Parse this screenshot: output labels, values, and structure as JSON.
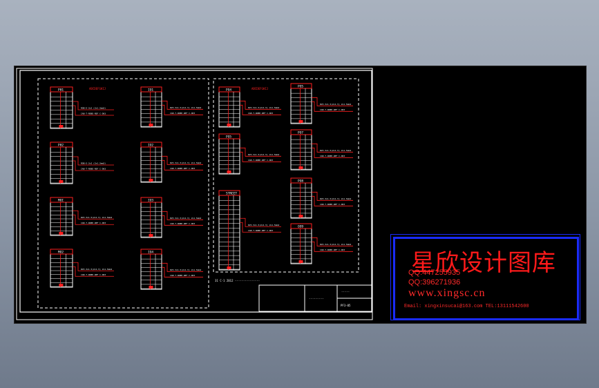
{
  "sheet": {
    "left_panels": [
      {
        "id": "P01",
        "lines": [
          "ROB-E-2x2 (2x1.5mm2)",
          "CAB-T-ROBE-REF  C-D03"
        ]
      },
      {
        "id": "P02",
        "lines": [
          "ROB-E-2x2 (2x1.5mm2)",
          "CAB-T-ROBE-REF  C-D03"
        ]
      },
      {
        "id": "MOI",
        "lines": [
          "RVV-3x1.5(2x1.5) 2x1.5mm2",
          "CAB-T-ROBE-REF  C-D03"
        ]
      },
      {
        "id": "MO2",
        "lines": [
          "RVV-3x1.5(2x1.5) 2x1.5mm2",
          "CAB-T-ROBE-REF  C-D03"
        ]
      }
    ],
    "mid_panels": [
      {
        "id": "IO1",
        "lines": [
          "RVV-3x1.5(2x1.5) 2x1.5mm2",
          "CAB-T-ROBE-REF  C-D03"
        ]
      },
      {
        "id": "IO2",
        "lines": [
          "RVV-3x1.5(2x1.5) 2x1.5mm2",
          "CAB-T-ROBE-REF  C-D03"
        ]
      },
      {
        "id": "IO3",
        "lines": [
          "RVV-3x1.5(2x1.5) 2x1.5mm2",
          "CAB-T-ROBE-REF  C-D03"
        ]
      },
      {
        "id": "IO4",
        "lines": [
          "RVV-3x1.5(2x1.5) 2x1.5mm2",
          "CAB-T-ROBE-REF  C-D03"
        ]
      }
    ],
    "right_panels": [
      {
        "id": "PO4",
        "lines": [
          "RVV-3x1.5(2x1.5) 2x1.5mm2",
          "CAB-T-ROBE-REF  C-D03"
        ]
      },
      {
        "id": "PO5",
        "lines": [
          "RVV-3x1.5(2x1.5) 2x1.5mm2",
          "CAB-T-ROBE-REF  C-D03"
        ]
      },
      {
        "id": "STREET",
        "lines": [
          "RVV-3x1.5(2x1.5) 2x1.5mm2",
          "CAB-T-ROBE-REF  C-D03"
        ]
      }
    ],
    "far_right_panels": [
      {
        "id": "PO5",
        "lines": [
          "RVV-3x1.5(2x1.5) 2x1.5mm2",
          "CAB-T-ROBE-REF  C-D03"
        ]
      },
      {
        "id": "PO7",
        "lines": [
          "RVV-3x1.5(2x1.5) 2x1.5mm2",
          "CAB-T-ROBE-REF  C-D03"
        ]
      },
      {
        "id": "PO8",
        "lines": [
          "RVV-3x1.5(2x1.5) 2x1.5mm2",
          "CAB-T-ROBE-REF  C-D03"
        ]
      },
      {
        "id": "OO9",
        "lines": [
          "RVV-3x1.5(2x1.5) 2x1.5mm2",
          "CAB-T-ROBE-REF  C-D03"
        ]
      }
    ],
    "group_left_title": "ABCDEFGHIJ",
    "group_right_title": "ABCDEFGHIJ",
    "bottom_note": "31  C-1  2012  ---------------",
    "title_block": {
      "name": "---------",
      "code": "PF3-05",
      "header": "-----"
    }
  },
  "watermark": {
    "title": "星欣设计图库",
    "qq1": "QQ:447255935",
    "qq2": "QQ:396271936",
    "site": "www.xingsc.cn",
    "email": "Email: xingxinsucai@163.com  TEL:13111542600"
  },
  "colors": {
    "background_top": "#a9b2bf",
    "viewport": "#000000",
    "line_white": "#ffffff",
    "line_red": "#ff2020",
    "watermark_blue": "#1a2cff",
    "watermark_red": "#ff1a1a"
  }
}
